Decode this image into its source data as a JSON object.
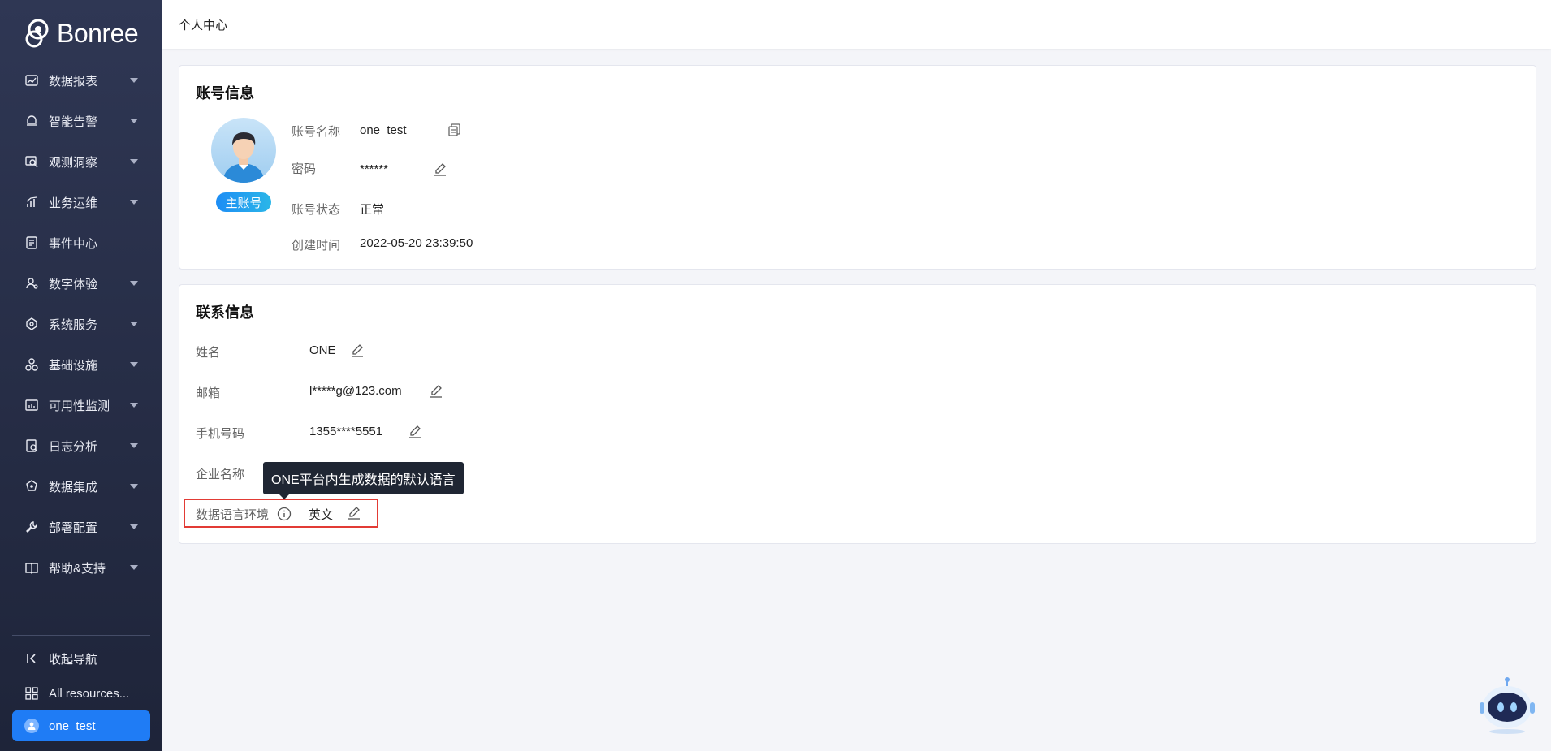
{
  "brand": {
    "logo_text": "Bonree"
  },
  "topbar": {
    "title": "个人中心"
  },
  "sidebar": {
    "items": [
      {
        "label": "数据报表",
        "icon": "chart-line-icon"
      },
      {
        "label": "智能告警",
        "icon": "alarm-icon"
      },
      {
        "label": "观测洞察",
        "icon": "observe-icon"
      },
      {
        "label": "业务运维",
        "icon": "bar-chart-icon"
      },
      {
        "label": "事件中心",
        "icon": "document-icon"
      },
      {
        "label": "数字体验",
        "icon": "user-experience-icon"
      },
      {
        "label": "系统服务",
        "icon": "network-icon"
      },
      {
        "label": "基础设施",
        "icon": "cluster-icon"
      },
      {
        "label": "可用性监测",
        "icon": "monitor-icon"
      },
      {
        "label": "日志分析",
        "icon": "log-icon"
      },
      {
        "label": "数据集成",
        "icon": "integration-icon"
      },
      {
        "label": "部署配置",
        "icon": "wrench-icon"
      },
      {
        "label": "帮助&支持",
        "icon": "book-icon"
      }
    ],
    "collapse_label": "收起导航",
    "all_resources_label": "All resources...",
    "user_label": "one_test"
  },
  "account": {
    "section_title": "账号信息",
    "badge": "主账号",
    "name_label": "账号名称",
    "name_value": "one_test",
    "password_label": "密码",
    "password_value": "******",
    "status_label": "账号状态",
    "status_value": "正常",
    "created_label": "创建时间",
    "created_value": "2022-05-20 23:39:50"
  },
  "contact": {
    "section_title": "联系信息",
    "surname_label": "姓名",
    "surname_value": "ONE",
    "email_label": "邮箱",
    "email_value": "l*****g@123.com",
    "phone_label": "手机号码",
    "phone_value": "1355****5551",
    "company_label": "企业名称",
    "language_label": "数据语言环境",
    "language_value": "英文",
    "tooltip": "ONE平台内生成数据的默认语言"
  },
  "colors": {
    "sidebar_bg": "#2f3754",
    "accent": "#1f7cf5",
    "highlight_border": "#e23b35"
  }
}
